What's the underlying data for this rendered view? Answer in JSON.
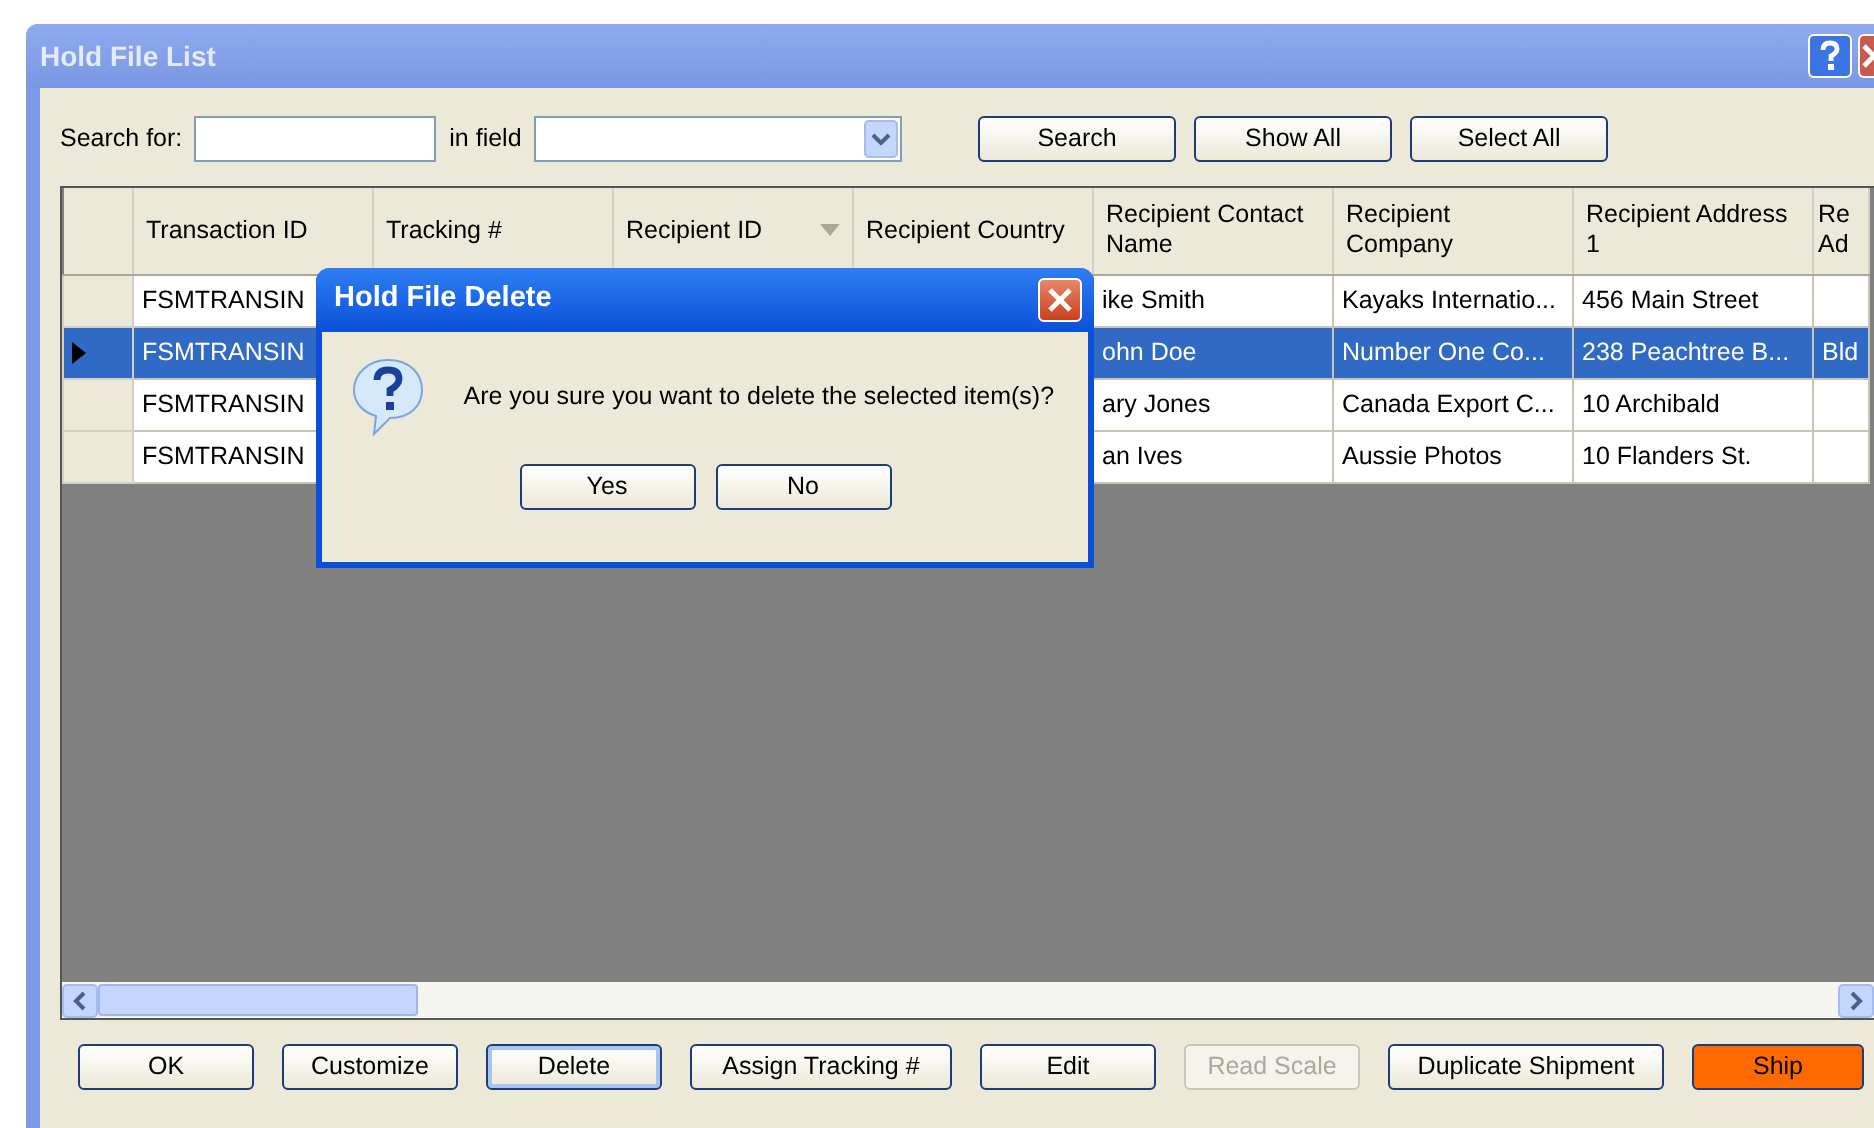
{
  "window": {
    "title": "Hold File List"
  },
  "search": {
    "label": "Search for:",
    "field_label": "in field",
    "buttons": [
      "Search",
      "Show All",
      "Select All"
    ]
  },
  "table": {
    "columns": [
      "Transaction ID",
      "Tracking #",
      "Recipient ID",
      "Recipient Country",
      "Recipient Contact Name",
      "Recipient Company",
      "Recipient Address 1",
      "Re Ad"
    ],
    "rows": [
      {
        "transaction_id": "FSMTRANSIN",
        "contact_name": "ike Smith",
        "company": "Kayaks Internatio...",
        "address_1": "456 Main Street",
        "selected": false
      },
      {
        "transaction_id": "FSMTRANSIN",
        "contact_name": "ohn Doe",
        "company": "Number One Co...",
        "address_1": "238 Peachtree B...",
        "column_8": "Bld",
        "selected": true
      },
      {
        "transaction_id": "FSMTRANSIN",
        "contact_name": "ary Jones",
        "company": "Canada Export C...",
        "address_1": "10 Archibald",
        "selected": false
      },
      {
        "transaction_id": "FSMTRANSIN",
        "contact_name": "an Ives",
        "company": "Aussie Photos",
        "address_1": "10 Flanders St.",
        "selected": false
      }
    ]
  },
  "dialog": {
    "title": "Hold File Delete",
    "message": "Are you sure you want to delete the selected item(s)?",
    "buttons": [
      "Yes",
      "No"
    ]
  },
  "buttons": [
    {
      "label": "OK",
      "kind": "normal"
    },
    {
      "label": "Customize",
      "kind": "normal"
    },
    {
      "label": "Delete",
      "kind": "focused"
    },
    {
      "label": "Assign Tracking #",
      "kind": "normal"
    },
    {
      "label": "Edit",
      "kind": "normal"
    },
    {
      "label": "Read Scale",
      "kind": "disabled"
    },
    {
      "label": "Duplicate Shipment",
      "kind": "normal"
    },
    {
      "label": "Ship",
      "kind": "accent"
    }
  ]
}
